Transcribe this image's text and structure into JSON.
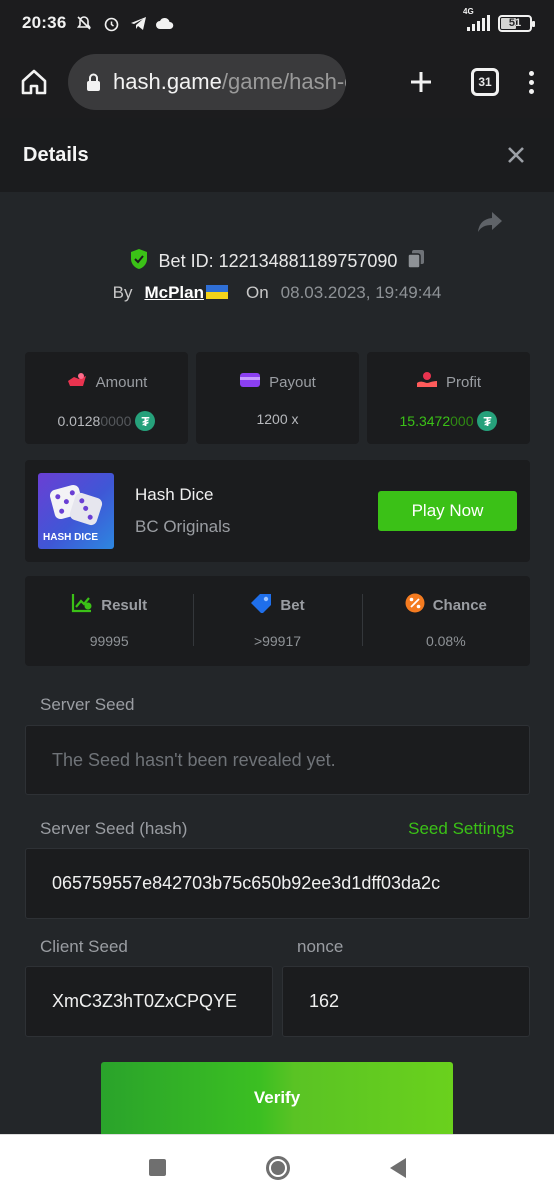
{
  "status_bar": {
    "time": "20:36",
    "network": "4G",
    "battery": "51"
  },
  "browser": {
    "url_host": "hash.game",
    "url_path": "/game/hash-dice",
    "tab_count": "31"
  },
  "details": {
    "title": "Details"
  },
  "bet": {
    "bet_id_label": "Bet ID: 122134881189757090",
    "by_label": "By",
    "user": "McPlan",
    "on_label": "On",
    "date": "08.03.2023, 19:49:44"
  },
  "stats": {
    "amount": {
      "label": "Amount",
      "value_main": "0.0128",
      "value_dim": "0000",
      "icon": "amount-icon"
    },
    "payout": {
      "label": "Payout",
      "value": "1200 x",
      "icon": "wallet-icon"
    },
    "profit": {
      "label": "Profit",
      "value_main": "15.3472",
      "value_dim": "000",
      "icon": "profit-icon"
    }
  },
  "game": {
    "thumb_text": "HASH DICE",
    "name": "Hash Dice",
    "provider": "BC Originals",
    "play_label": "Play Now"
  },
  "result": {
    "result_label": "Result",
    "result_value": "99995",
    "bet_label": "Bet",
    "bet_value": ">99917",
    "chance_label": "Chance",
    "chance_value": "0.08%"
  },
  "seeds": {
    "server_seed_label": "Server Seed",
    "server_seed_value": "The Seed hasn't been revealed yet.",
    "server_hash_label": "Server Seed (hash)",
    "seed_settings_label": "Seed Settings",
    "server_hash_value": "065759557e842703b75c650b92ee3d1dff03da2c",
    "client_seed_label": "Client Seed",
    "client_seed_value": "XmC3Z3hT0ZxCPQYE",
    "nonce_label": "nonce",
    "nonce_value": "162"
  },
  "verify_label": "Verify",
  "colors": {
    "accent_green": "#3bc117",
    "panel": "#1b1c1e",
    "background": "#232629"
  }
}
